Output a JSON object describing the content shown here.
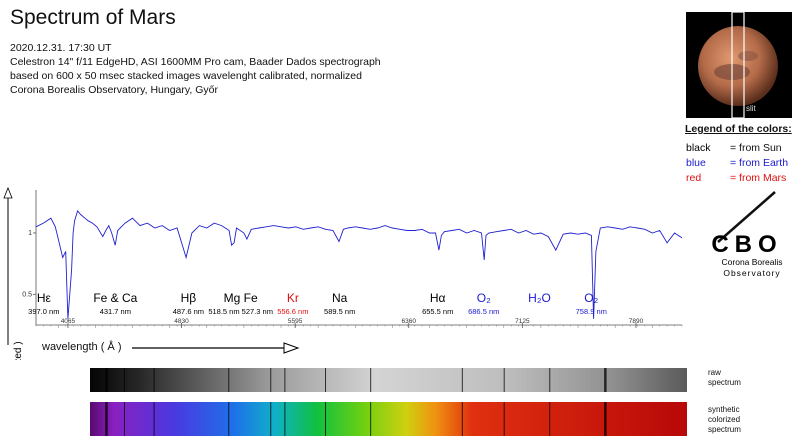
{
  "header": {
    "title": "Spectrum of Mars",
    "lines": [
      "2020.12.31.   17:30 UT",
      "Celestron 14\" f/11 EdgeHD, ASI 1600MM Pro cam, Baader Dados spectrograph",
      "based on 600 x 50   msec stacked images  wavelenght calibrated,  normalized",
      "Corona Borealis Observatory, Hungary, Győr"
    ]
  },
  "mars_image": {
    "slit_label": "slit"
  },
  "legend": {
    "title": "Legend of the colors:",
    "items": [
      {
        "key": "black",
        "desc": "= from Sun",
        "color": "#000000"
      },
      {
        "key": "blue",
        "desc": "= from Earth",
        "color": "#1a1ad0"
      },
      {
        "key": "red",
        "desc": "= from Mars",
        "color": "#e01010"
      }
    ]
  },
  "logo": {
    "letters": "CBO",
    "line1": "Corona Borealis",
    "line2": "Observatory"
  },
  "strips": {
    "raw_label": "raw\nspectrum",
    "synthetic_label": "synthetic\ncolorized\nspectrum"
  },
  "colors": {
    "spectrum_line": "#2020d0"
  },
  "chart_data": {
    "type": "line",
    "xlabel": "wavelength  ( Å )",
    "ylabel": "intensity ( normalized )",
    "xlim": [
      3850,
      8200
    ],
    "ylim": [
      0.25,
      1.35
    ],
    "xticks": [
      4065,
      4830,
      5595,
      6360,
      7125,
      7890
    ],
    "yticks": [
      {
        "value": 1,
        "label": "1"
      },
      {
        "value": 0.5,
        "label": "0.5"
      }
    ],
    "series": [
      {
        "x": [
          3850,
          3900,
          3950,
          3980,
          4000,
          4030,
          4050,
          4065,
          4090,
          4100,
          4110,
          4130,
          4150,
          4180,
          4200,
          4230,
          4260,
          4300,
          4320,
          4340,
          4360,
          4383,
          4400,
          4450,
          4500,
          4550,
          4600,
          4650,
          4700,
          4750,
          4800,
          4861,
          4900,
          4950,
          5000,
          5050,
          5100,
          5150,
          5167,
          5184,
          5200,
          5250,
          5270,
          5300,
          5350,
          5400,
          5450,
          5500,
          5550,
          5600,
          5650,
          5700,
          5750,
          5800,
          5850,
          5890,
          5920,
          5950,
          6000,
          6050,
          6100,
          6150,
          6200,
          6250,
          6300,
          6350,
          6400,
          6450,
          6500,
          6540,
          6563,
          6580,
          6600,
          6650,
          6700,
          6750,
          6800,
          6850,
          6868,
          6880,
          6900,
          6950,
          7000,
          7050,
          7100,
          7150,
          7200,
          7250,
          7300,
          7350,
          7400,
          7450,
          7500,
          7550,
          7590,
          7605,
          7620,
          7650,
          7700,
          7750,
          7800,
          7850,
          7900,
          7950,
          8000,
          8050,
          8100,
          8150,
          8200
        ],
        "y": [
          1.05,
          1.08,
          1.12,
          1.05,
          0.95,
          0.8,
          0.85,
          0.3,
          0.7,
          1.0,
          1.1,
          1.18,
          1.15,
          1.12,
          1.1,
          1.08,
          1.05,
          0.97,
          1.02,
          1.06,
          1.0,
          0.9,
          1.02,
          1.08,
          1.12,
          1.06,
          1.08,
          1.04,
          1.06,
          1.02,
          1.04,
          0.8,
          1.0,
          1.06,
          1.04,
          1.08,
          1.06,
          1.02,
          0.9,
          0.92,
          1.04,
          1.0,
          0.95,
          1.03,
          1.04,
          1.05,
          1.06,
          1.05,
          1.04,
          1.05,
          1.03,
          1.04,
          1.05,
          1.03,
          1.02,
          0.93,
          1.03,
          1.04,
          1.05,
          1.04,
          1.03,
          1.04,
          1.06,
          1.04,
          1.03,
          1.02,
          1.02,
          1.03,
          1.0,
          1.0,
          0.86,
          0.98,
          1.01,
          1.02,
          1.03,
          1.0,
          1.02,
          1.0,
          0.78,
          0.98,
          1.0,
          1.01,
          1.02,
          1.03,
          1.0,
          1.02,
          0.99,
          1.0,
          0.97,
          0.86,
          0.99,
          1.0,
          0.99,
          1.0,
          0.98,
          0.3,
          0.85,
          1.04,
          1.05,
          1.04,
          1.03,
          1.05,
          1.04,
          1.03,
          1.0,
          1.02,
          0.92,
          1.0,
          0.96
        ]
      }
    ],
    "lines": [
      {
        "label": "Hε",
        "nm": "397.0 nm",
        "color": "#000000",
        "wavelength": 3970
      },
      {
        "label": "Fe & Ca",
        "nm": "431.7 nm",
        "color": "#000000",
        "wavelength": 4317
      },
      {
        "label": "Hβ",
        "nm": "487.6 nm",
        "color": "#000000",
        "wavelength": 4876
      },
      {
        "label": "Mg Fe",
        "nm": "518.5 nm  527.3 nm",
        "color": "#000000",
        "wavelength": 5228
      },
      {
        "label": "Kr",
        "nm": "556.6 nm",
        "color": "#e01010",
        "wavelength": 5566
      },
      {
        "label": "Na",
        "nm": "589.5 nm",
        "color": "#000000",
        "wavelength": 5895
      },
      {
        "label": "Hα",
        "nm": "655.5 nm",
        "color": "#000000",
        "wavelength": 6555
      },
      {
        "label": "O₂",
        "nm": "686.5 nm",
        "color": "#1a1ad0",
        "wavelength": 6865
      },
      {
        "label": "H₂O",
        "nm": "",
        "color": "#1a1ad0",
        "wavelength": 7200
      },
      {
        "label": "O₂",
        "nm": "758.9 nm",
        "color": "#1a1ad0",
        "wavelength": 7589
      }
    ],
    "absorption_lines": [
      3970,
      4101,
      4317,
      4861,
      5167,
      5270,
      5566,
      5895,
      6563,
      6868,
      7200,
      7605
    ]
  }
}
